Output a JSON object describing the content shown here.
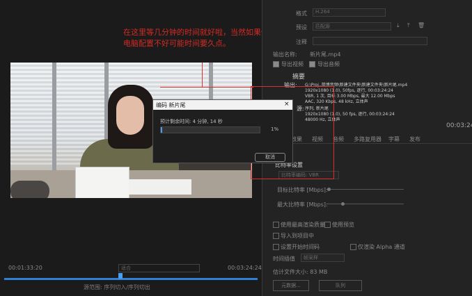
{
  "annotation": {
    "line1": "在这里等几分钟的时间就好啦，当然如果你",
    "line2": "电脑配置不好可能时间要久点。"
  },
  "dialog": {
    "title": "编码 新片尾",
    "close_glyph": "×",
    "estimate": "预计剩余时间: 4 分钟, 14 秒",
    "progress": 0.01,
    "progress_label": "1%",
    "cancel": "取消"
  },
  "summary": {
    "heading": "摘要",
    "output_label": "输出:",
    "output_lines": [
      "G:\\Proj..简博音频\\新建文件夹\\新建文件夹\\新片尾.mp4",
      "1920x1080 (1.0), 50fps, 逐行, 00:03:24:24",
      "VBR, 1 次, 目标 3.00 Mbps, 最大 12.00 Mbps",
      "AAC, 320 Kbps, 48 kHz, 立体声"
    ],
    "source_label": "源:",
    "source_lines": [
      "序列, 新片尾",
      "1920x1080 (1.0), 50 fps, 逐行, 00:03:24:24",
      "48000 Hz, 立体声"
    ]
  },
  "right_panel": {
    "preset_label": "格式",
    "preset_value": "H.264",
    "preset2_label": "预设",
    "preset2_value": "匹配源",
    "comment_label": "注释",
    "output_name_label": "输出名称:",
    "output_name_value": "新片尾.mp4",
    "export_video": "导出视频",
    "export_audio": "导出音频",
    "tabs": [
      "效果",
      "视频",
      "音频",
      "多路复用器",
      "字幕",
      "发布"
    ],
    "bitrate_heading": "比特率设置",
    "bitrate_encoding": "比特率编码: VBR",
    "target_bitrate": "目标比特率 [Mbps]:",
    "max_bitrate": "最大比特率 [Mbps]:",
    "use_max_render": "使用最高渲染质量",
    "use_preview": "使用预览",
    "import_project": "导入到项目中",
    "set_start_timecode": "设置开始时间码",
    "render_alpha": "仅渲染 Alpha 通道",
    "time_interpolation": "时间插值",
    "time_interpolation_value": "帧采样",
    "estimated_size": "估计文件大小: 83 MB",
    "metadata_btn": "元数据...",
    "queue_btn": "队列",
    "timecode": "00:03:24"
  },
  "timeline": {
    "timecode_left": "00:01:33:20",
    "timecode_right": "00:03:24:24",
    "fit_label": "适合",
    "source_range": "源范围: 序列切入/序列切出"
  }
}
